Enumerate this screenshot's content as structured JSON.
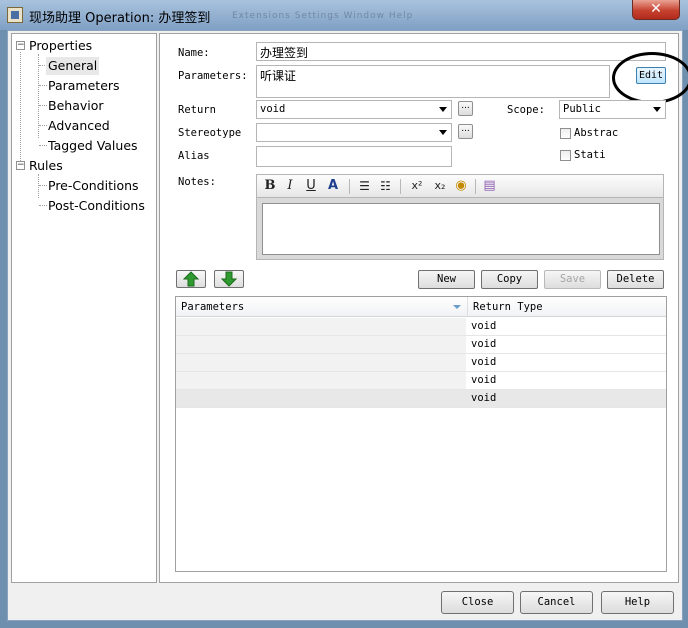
{
  "window": {
    "title": "现场助理 Operation: 办理签到",
    "ghost_menu": "Extensions   Settings   Window   Help",
    "close_glyph": "✕"
  },
  "tree": {
    "properties": "Properties",
    "general": "General",
    "parameters": "Parameters",
    "behavior": "Behavior",
    "advanced": "Advanced",
    "tagged_values": "Tagged Values",
    "rules": "Rules",
    "pre_conditions": "Pre-Conditions",
    "post_conditions": "Post-Conditions",
    "expander": "−"
  },
  "form": {
    "name_label": "Name:",
    "name_value": "办理签到",
    "parameters_label": "Parameters:",
    "parameters_value": "听课证",
    "edit_label": "Edit",
    "return_label": "Return",
    "return_value": "void",
    "scope_label": "Scope:",
    "scope_value": "Public",
    "stereotype_label": "Stereotype",
    "stereotype_value": "",
    "alias_label": "Alias",
    "alias_value": "",
    "notes_label": "Notes:",
    "abstract_label": "Abstrac",
    "static_label": "Stati",
    "dots": "..."
  },
  "toolbar": {
    "bold": "B",
    "italic": "I",
    "underline": "U",
    "color": "A",
    "bullets": "☰",
    "numbering": "☷",
    "superscript": "x²",
    "subscript": "x₂",
    "link": "◉",
    "paste": "▤"
  },
  "list_buttons": {
    "new": "New",
    "copy": "Copy",
    "save": "Save",
    "delete": "Delete",
    "up": "▲",
    "down": "▼"
  },
  "grid": {
    "columns": [
      "Parameters",
      "Return Type"
    ],
    "rows": [
      {
        "parameters": "",
        "return_type": "void"
      },
      {
        "parameters": "",
        "return_type": "void"
      },
      {
        "parameters": "",
        "return_type": "void"
      },
      {
        "parameters": "",
        "return_type": "void"
      },
      {
        "parameters": "",
        "return_type": "void"
      }
    ]
  },
  "footer": {
    "close": "Close",
    "cancel": "Cancel",
    "help": "Help"
  },
  "colors": {
    "title_bar": "#8fb0d4",
    "close_button": "#c6422f",
    "highlight_ring": "#000000",
    "arrow_green": "#2f9a2f"
  }
}
